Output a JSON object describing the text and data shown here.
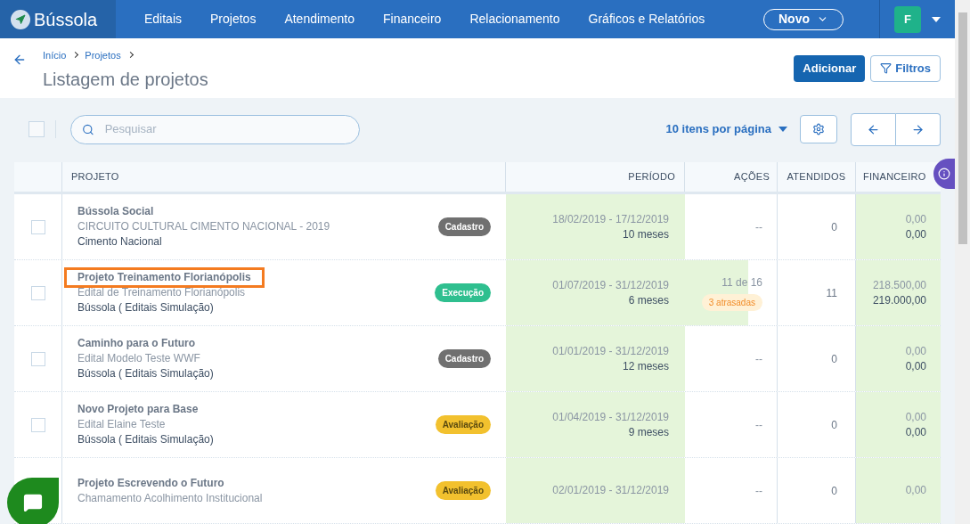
{
  "app": {
    "logo": "Bússola"
  },
  "nav": {
    "items": [
      "Editais",
      "Projetos",
      "Atendimento",
      "Financeiro",
      "Relacionamento",
      "Gráficos e Relatórios"
    ],
    "new_button": "Novo",
    "avatar": "F"
  },
  "breadcrumb": [
    "Início",
    "Projetos"
  ],
  "page_title": "Listagem de projetos",
  "actions": {
    "add": "Adicionar",
    "filters": "Filtros"
  },
  "toolbar": {
    "select_all_checked": false,
    "search_placeholder": "Pesquisar",
    "per_page": "10 itens por página"
  },
  "table": {
    "columns": [
      "PROJETO",
      "PERÍODO",
      "AÇÕES",
      "ATENDIDOS",
      "FINANCEIRO"
    ],
    "rows": [
      {
        "checked": false,
        "highlighted": false,
        "title": "Bússola Social",
        "subtitle": "CIRCUITO CULTURAL CIMENTO NACIONAL - 2019",
        "org": "Cimento Nacional",
        "status": "Cadastro",
        "color": "#707070",
        "period": "18/02/2019 - 17/12/2019",
        "duration": "10 meses",
        "actions": "--",
        "attended": "0",
        "fin_planned": "0,00",
        "fin_done": "0,00"
      },
      {
        "checked": false,
        "highlighted": true,
        "title": "Projeto Treinamento Florianópolis",
        "subtitle": "Edital de Treinamento Florianópolis",
        "org": "Bússola ( Editais Simulação)",
        "status": "Execução",
        "color": "#2fbf8f",
        "period": "01/07/2019 - 31/12/2019",
        "duration": "6 meses",
        "actions": "11 de 16",
        "level": 0.69,
        "late": "3 atrasadas",
        "attended": "11",
        "fin_planned": "218.500,00",
        "fin_done": "219.000,00"
      },
      {
        "checked": false,
        "highlighted": false,
        "title": "Caminho para o Futuro",
        "subtitle": "Edital Modelo Teste WWF",
        "org": "Bússola ( Editais Simulação)",
        "status": "Cadastro",
        "color": "#707070",
        "period": "01/01/2019 - 31/12/2019",
        "duration": "12 meses",
        "actions": "--",
        "attended": "0",
        "fin_planned": "0,00",
        "fin_done": "0,00"
      },
      {
        "checked": false,
        "highlighted": false,
        "title": "Novo Projeto para Base",
        "subtitle": "Edital Elaine Teste",
        "org": "Bússola ( Editais Simulação)",
        "status": "Avaliação",
        "color": "#f2c12e",
        "period": "01/04/2019 - 31/12/2019",
        "duration": "9 meses",
        "actions": "--",
        "attended": "0",
        "fin_planned": "0,00",
        "fin_done": "0,00"
      },
      {
        "highlighted": false,
        "title": "Projeto Escrevendo o Futuro",
        "subtitle": "Chamamento Acolhimento Institucional",
        "status": "Avaliação",
        "color": "#f2c12e",
        "period": "02/01/2019 - 31/12/2019",
        "actions": "--",
        "attended": "0",
        "fin_planned": "0,00"
      }
    ]
  }
}
